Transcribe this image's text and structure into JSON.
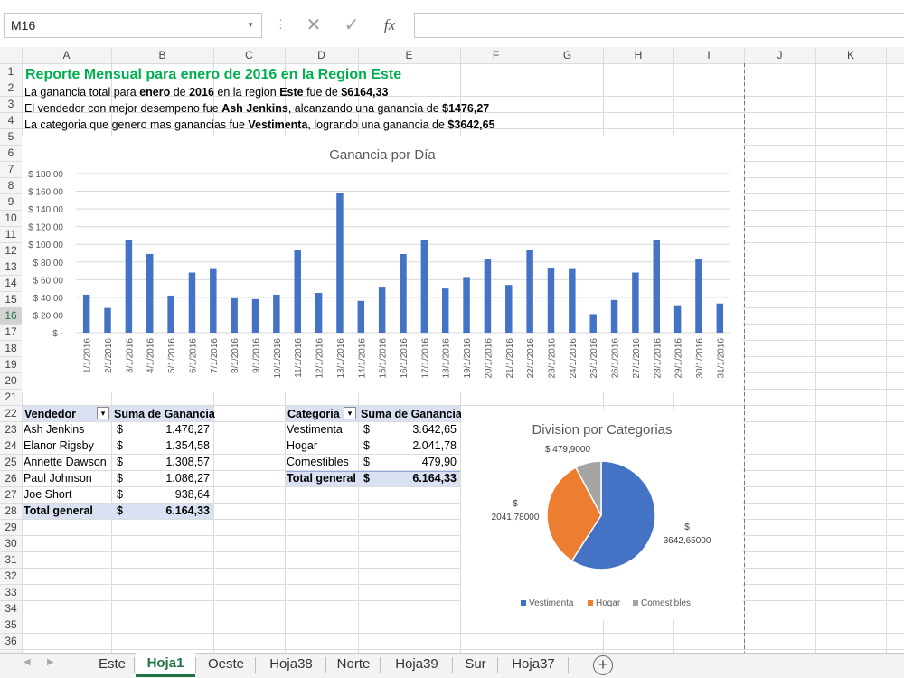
{
  "formula_bar": {
    "name_box": "M16",
    "fx_label": "fx",
    "formula": ""
  },
  "columns": [
    "A",
    "B",
    "C",
    "D",
    "E",
    "F",
    "G",
    "H",
    "I",
    "J",
    "K"
  ],
  "rows": [
    "1",
    "2",
    "3",
    "4",
    "5",
    "6",
    "7",
    "8",
    "9",
    "10",
    "11",
    "12",
    "13",
    "14",
    "15",
    "16",
    "17",
    "18",
    "19",
    "20",
    "21",
    "22",
    "23",
    "24",
    "25",
    "26",
    "27",
    "28",
    "29",
    "30",
    "31",
    "32",
    "33",
    "34",
    "35",
    "36"
  ],
  "selected": {
    "col": "M",
    "row": "16"
  },
  "report": {
    "title": "Reporte Mensual para enero de 2016 en la Region Este",
    "line2": {
      "a": "La ganancia total para ",
      "b": "enero",
      "c": " de ",
      "d": "2016",
      "e": " en la region ",
      "f": "Este",
      "g": " fue de ",
      "h": "$6164,33"
    },
    "line3": {
      "a": "El vendedor con mejor desempeno fue ",
      "b": "Ash Jenkins",
      "c": ", alcanzando una ganancia de ",
      "d": "$1476,27"
    },
    "line4": {
      "a": "La categoria que genero mas ganancias fue ",
      "b": "Vestimenta",
      "c": ", logrando una ganancia de ",
      "d": "$3642,65"
    }
  },
  "pivot_vendedor": {
    "header": "Vendedor",
    "header_value": "Suma de Ganancia",
    "rows": [
      {
        "name": "Ash Jenkins",
        "cur": "$",
        "value": "1.476,27"
      },
      {
        "name": "Elanor Rigsby",
        "cur": "$",
        "value": "1.354,58"
      },
      {
        "name": "Annette Dawson",
        "cur": "$",
        "value": "1.308,57"
      },
      {
        "name": "Paul Johnson",
        "cur": "$",
        "value": "1.086,27"
      },
      {
        "name": "Joe Short",
        "cur": "$",
        "value": "938,64"
      }
    ],
    "total": {
      "name": "Total general",
      "cur": "$",
      "value": "6.164,33"
    }
  },
  "pivot_categoria": {
    "header": "Categoria",
    "header_value": "Suma de Ganancia",
    "rows": [
      {
        "name": "Vestimenta",
        "cur": "$",
        "value": "3.642,65"
      },
      {
        "name": "Hogar",
        "cur": "$",
        "value": "2.041,78"
      },
      {
        "name": "Comestibles",
        "cur": "$",
        "value": "479,90"
      }
    ],
    "total": {
      "name": "Total general",
      "cur": "$",
      "value": "6.164,33"
    }
  },
  "chart_data": [
    {
      "type": "bar",
      "title": "Ganancia por Día",
      "categories": [
        "1/1/2016",
        "2/1/2016",
        "3/1/2016",
        "4/1/2016",
        "5/1/2016",
        "6/1/2016",
        "7/1/2016",
        "8/1/2016",
        "9/1/2016",
        "10/1/2016",
        "11/1/2016",
        "12/1/2016",
        "13/1/2016",
        "14/1/2016",
        "15/1/2016",
        "16/1/2016",
        "17/1/2016",
        "18/1/2016",
        "19/1/2016",
        "20/1/2016",
        "21/1/2016",
        "22/1/2016",
        "23/1/2016",
        "24/1/2016",
        "25/1/2016",
        "26/1/2016",
        "27/1/2016",
        "28/1/2016",
        "29/1/2016",
        "30/1/2016",
        "31/1/2016"
      ],
      "values": [
        43,
        28,
        105,
        89,
        42,
        68,
        72,
        39,
        38,
        43,
        94,
        45,
        158,
        36,
        51,
        89,
        105,
        50,
        63,
        83,
        54,
        94,
        73,
        72,
        21,
        37,
        68,
        105,
        31,
        83,
        33
      ],
      "ylim": [
        0,
        180
      ],
      "yticks": [
        "$ -",
        "$ 20,00",
        "$ 40,00",
        "$ 60,00",
        "$ 80,00",
        "$ 100,00",
        "$ 120,00",
        "$ 140,00",
        "$ 160,00",
        "$ 180,00"
      ],
      "grid": true,
      "color": "#4472c4"
    },
    {
      "type": "pie",
      "title": "Division por Categorias",
      "labels": [
        "Vestimenta",
        "Hogar",
        "Comestibles"
      ],
      "values": [
        3642.65,
        2041.78,
        479.9
      ],
      "data_labels": [
        [
          "$",
          "3642,65000"
        ],
        [
          "$",
          "2041,78000"
        ],
        [
          "$ 479,9000"
        ]
      ],
      "colors": [
        "#4472c4",
        "#ed7d31",
        "#a5a5a5"
      ],
      "legend": "bottom"
    }
  ],
  "tabs": [
    {
      "label": "Este",
      "active": false
    },
    {
      "label": "Hoja1",
      "active": true
    },
    {
      "label": "Oeste",
      "active": false
    },
    {
      "label": "Hoja38",
      "active": false
    },
    {
      "label": "Norte",
      "active": false
    },
    {
      "label": "Hoja39",
      "active": false
    },
    {
      "label": "Sur",
      "active": false
    },
    {
      "label": "Hoja37",
      "active": false
    }
  ],
  "add_sheet_label": "+"
}
